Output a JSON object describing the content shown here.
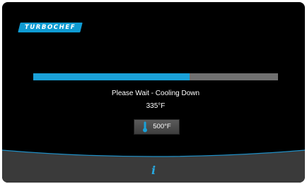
{
  "brand": {
    "logo_text": "TURBOCHEF"
  },
  "progress": {
    "fraction": 0.64
  },
  "status": {
    "message": "Please Wait - Cooling Down",
    "current_temp": "335°F"
  },
  "setpoint": {
    "label": "500°F",
    "icon": "thermometer-icon"
  },
  "footer": {
    "info_icon_glyph": "i"
  },
  "colors": {
    "accent": "#1aa1d8",
    "progress_track": "#707070",
    "background": "#000000",
    "footer": "#3a3a3a",
    "footer_edge": "#1f8fc6"
  }
}
